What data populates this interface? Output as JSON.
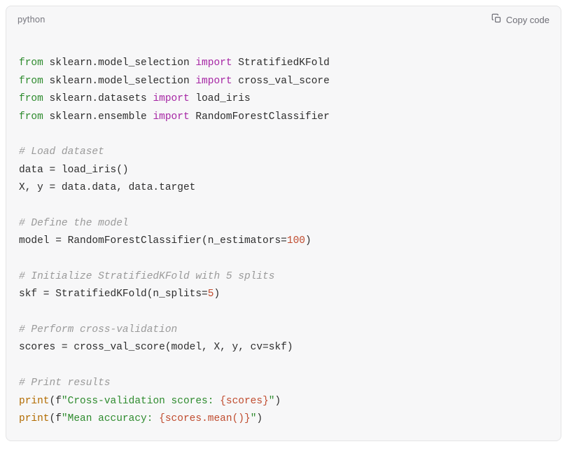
{
  "header": {
    "language": "python",
    "copy_label": "Copy code"
  },
  "code": {
    "lines": [
      {
        "type": "blank"
      },
      {
        "type": "import",
        "kw1": "from",
        "mod": "sklearn.model_selection",
        "kw2": "import",
        "name": "StratifiedKFold"
      },
      {
        "type": "import",
        "kw1": "from",
        "mod": "sklearn.model_selection",
        "kw2": "import",
        "name": "cross_val_score"
      },
      {
        "type": "import",
        "kw1": "from",
        "mod": "sklearn.datasets",
        "kw2": "import",
        "name": "load_iris"
      },
      {
        "type": "import",
        "kw1": "from",
        "mod": "sklearn.ensemble",
        "kw2": "import",
        "name": "RandomForestClassifier"
      },
      {
        "type": "blank"
      },
      {
        "type": "comment",
        "text": "# Load dataset"
      },
      {
        "type": "plain",
        "text": "data = load_iris()"
      },
      {
        "type": "plain",
        "text": "X, y = data.data, data.target"
      },
      {
        "type": "blank"
      },
      {
        "type": "comment",
        "text": "# Define the model"
      },
      {
        "type": "call_num",
        "pre": "model = RandomForestClassifier(n_estimators=",
        "num": "100",
        "post": ")"
      },
      {
        "type": "blank"
      },
      {
        "type": "comment",
        "text": "# Initialize StratifiedKFold with 5 splits"
      },
      {
        "type": "call_num",
        "pre": "skf = StratifiedKFold(n_splits=",
        "num": "5",
        "post": ")"
      },
      {
        "type": "blank"
      },
      {
        "type": "comment",
        "text": "# Perform cross-validation"
      },
      {
        "type": "plain",
        "text": "scores = cross_val_score(model, X, y, cv=skf)"
      },
      {
        "type": "blank"
      },
      {
        "type": "comment",
        "text": "# Print results"
      },
      {
        "type": "print",
        "func": "print",
        "open": "(f",
        "str1": "\"Cross-validation scores: ",
        "interp": "{scores}",
        "str2": "\"",
        "close": ")"
      },
      {
        "type": "print",
        "func": "print",
        "open": "(f",
        "str1": "\"Mean accuracy: ",
        "interp": "{scores.mean()}",
        "str2": "\"",
        "close": ")"
      }
    ]
  }
}
